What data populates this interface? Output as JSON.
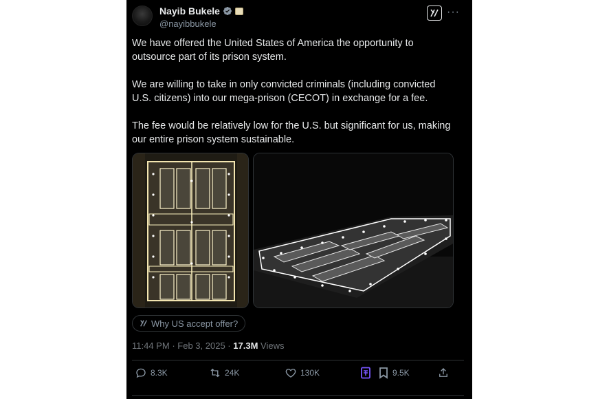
{
  "author": {
    "display_name": "Nayib Bukele",
    "handle": "@nayibbukele"
  },
  "icons": {
    "verified": "verified-badge-icon",
    "flag": "flag-emoji-icon",
    "grok": "grok-icon",
    "more": "more-icon",
    "reply": "reply-icon",
    "retweet": "retweet-icon",
    "like": "like-icon",
    "grok_action": "grok-analyze-icon",
    "bookmark": "bookmark-icon",
    "share": "share-icon"
  },
  "tweet": {
    "paragraphs": [
      "We have offered the United States of America the opportunity to outsource part of its prison system.",
      "We are willing to take in only convicted criminals (including convicted U.S. citizens) into our mega-prison (CECOT) in exchange for a fee.",
      "The fee would be relatively low for the U.S. but significant for us, making our entire prison system sustainable."
    ]
  },
  "grok_prompt": "Why US accept offer?",
  "meta": {
    "time": "11:44 PM",
    "separator": "·",
    "date": "Feb 3, 2025",
    "views_count": "17.3M",
    "views_label": "Views"
  },
  "actions": {
    "replies": "8.3K",
    "reposts": "24K",
    "likes": "130K",
    "bookmarks": "9.5K"
  },
  "colors": {
    "background": "#000000",
    "text_primary": "#e7e9ea",
    "text_secondary": "#8b98a5",
    "border": "#2f3336",
    "verified": "#1d9bf0",
    "grok_purple": "#7856ff"
  }
}
